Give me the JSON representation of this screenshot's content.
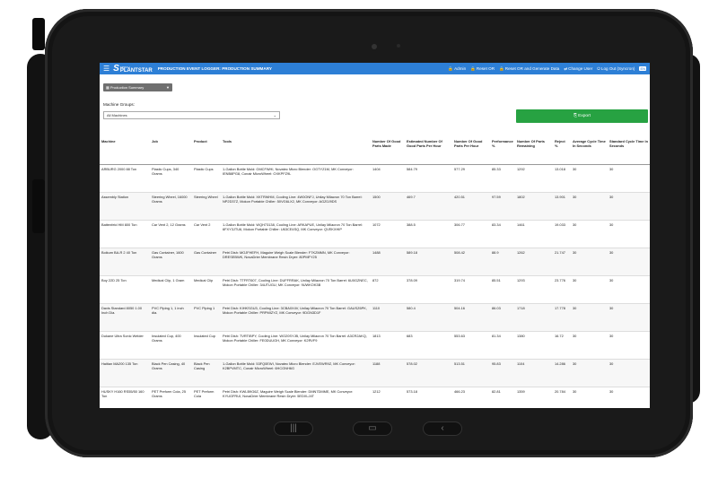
{
  "app": {
    "logo_small": "EPOCH",
    "logo_name": "PLANTSTAR",
    "title": "PRODUCTION EVENT LOGGER: PRODUCTION SUMMARY",
    "actions": [
      {
        "icon": "lock-icon",
        "label": "Admin"
      },
      {
        "icon": "lock-icon",
        "label": "Reset OR"
      },
      {
        "icon": "lock-icon",
        "label": "Reset OR and Generate Data"
      },
      {
        "icon": "swap-icon",
        "label": "Change User"
      },
      {
        "icon": "logout-icon",
        "label": "Log Out (Syncron)"
      }
    ],
    "lang": "EN"
  },
  "controls": {
    "report_value": "Production Summary",
    "machine_groups_label": "Machine Groups:",
    "machine_groups_value": "All Machines",
    "export_label": "Export"
  },
  "table": {
    "headers": [
      "Machine",
      "Job",
      "Product",
      "Tools",
      "Number Of Good Parts Made",
      "Estimated Number Of Good Parts Per Hour",
      "Number Of Good Parts Per Hour",
      "Performance %",
      "Number Of Parts Remaining",
      "Reject %",
      "Average Cycle Time In Seconds",
      "Standard Cycle Time In Seconds"
    ],
    "rows": [
      [
        "ARBURG 2000 88 Ton",
        "Plastic Cups, 340 Grams",
        "Plastic Cups",
        "1-Gallon Bottle Mold: GMCFWHI, Novatec Micro Blender: OGTYZ1M, MK Conveyor: IENB8PG8, Conair MicroWheel: OXKPFZ9L",
        "1404",
        "584.79",
        "577.29",
        "85.33",
        "1292",
        "13.018",
        "30",
        "30"
      ],
      [
        "Assembly Station",
        "Steering Wheel, 16000 Grams",
        "Steering Wheel",
        "1-Gallon Bottle Mold: XKTRWHM, Cooling Line: 4W0ONFJ, Unilay Milacron 70 Ton Barrel: NP2D37Z, Mokon Portable Chiller: 50VG6LX2, MK Conveyor: AGZ0J9DS",
        "1500",
        "469.7",
        "420.51",
        "97.59",
        "1802",
        "13.901",
        "30",
        "30"
      ],
      [
        "Battenfeld HM 800 Ton",
        "Car Vent 2, 12 Grams",
        "Car Vent 2",
        "1-Gallon Bottle Mold: WQH73138, Cooling Line: ARKAPUE, Unilay Milacron 70 Ton Barrel: 6FXY3JTU6, Mokon Portable Chiller: U63CE4SQ, MK Conveyor: QVEKXHIP",
        "1072",
        "388.5",
        "306.77",
        "83.34",
        "1461",
        "19.033",
        "30",
        "30"
      ],
      [
        "Boikum BA-R 2 40 Ton",
        "Gas Container, 1600 Grams",
        "Gas Container",
        "Petri Dish: MOJFHEFH, Maguire Weigh Scale Blender: F7KZMMN, MK Conveyor: DRESEBWK, NovaDrier Membrane Resin Dryer: 80PMFY25",
        "1488",
        "589.18",
        "508.42",
        "88.9",
        "1262",
        "21.747",
        "30",
        "30"
      ],
      [
        "Boy 22D 25 Ton",
        "Medical Clip, 1 Gram",
        "Medical Clip",
        "Petri Dish: TTFRT607, Cooling Line: DUFFRRAK, Unilay Milacron 70 Ton Barrel: 6U0GZNEC, Mokon Portable Chiller: 34UTUGU, MK Conveyor: 9UWKOK3B",
        "872",
        "378.09",
        "319.74",
        "85.51",
        "1293",
        "23.776",
        "30",
        "30"
      ],
      [
        "Davis Standard 8050 1.00 Inch Dia.",
        "PVC Piping 1, 1 inch dia.",
        "PVC Piping 1",
        "Petri Dish: KIHKSGU3, Cooling Line: 3CBA0X4V, Unilay Milacron 70 Ton Barrel: GAUSZ6PK, Mokon Portable Chiller: PRPMIZYZ, MK Conveyor: 9DGN3D1F",
        "1110",
        "580.4",
        "504.16",
        "86.03",
        "1718",
        "17.778",
        "30",
        "30"
      ],
      [
        "Dukane Ultra Sonic Welder",
        "Insulated Cup, 400 Grams",
        "Insulated Cup",
        "Petri Dish: TVRTIBPY, Cooling Line: WO20SYJB, Unilay Milacron 70 Ton Barrel: A3CR2AKQ, Mokon Portable Chiller: FE0DUUGH, MK Conveyor: K2RVF9",
        "1813",
        "683",
        "553.63",
        "81.34",
        "1380",
        "16.72",
        "30",
        "30"
      ],
      [
        "Haitian MA200 135 Ton",
        "Black Pen Casing, 40 Grams",
        "Black Pen Casing",
        "1-Gallon Bottle Mold: 53FQ0EWI, Novatec Micro Blender: EJVEWR9Z, MK Conveyor: K2BPVMTC, Conair MicroWheel: 6HCGNH6G",
        "1188",
        "578.02",
        "513.51",
        "95.83",
        "1104",
        "14.286",
        "30",
        "30"
      ],
      [
        "HUSKY H160 RS55/50 160 Ton",
        "PET Preform Cola, 25 Grams",
        "PET Preform Cola",
        "Petri Dish: KWLB9G6Z, Maguire Weigh Scale Blender: DMN7DMME, MK Conveyor: KYUGFRUI, NovaDrier Membrane Resin Dryer: 5EDXLJ4T",
        "1212",
        "573.18",
        "466.23",
        "82.81",
        "1359",
        "20.784",
        "30",
        "30"
      ]
    ]
  }
}
